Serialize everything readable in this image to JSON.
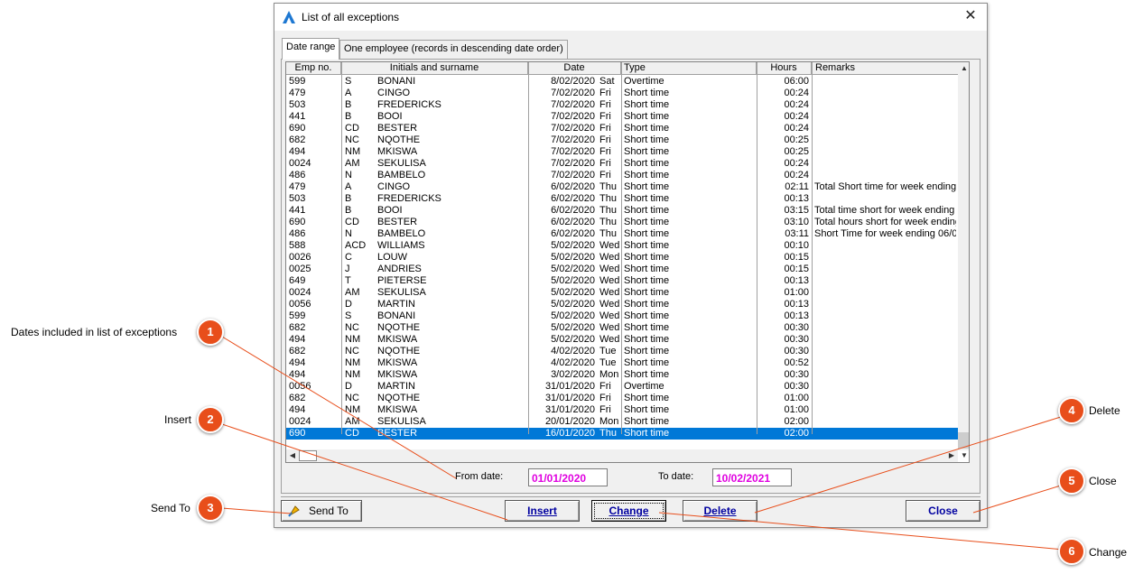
{
  "window": {
    "title": "List of all exceptions",
    "close_glyph": "✕"
  },
  "tabs": [
    {
      "label": "Date range"
    },
    {
      "label": "One employee (records in descending date order)"
    }
  ],
  "table": {
    "columns": [
      "Emp no.",
      "Initials and surname",
      "Date",
      "Type",
      "Hours",
      "Remarks"
    ],
    "rows": [
      [
        "599",
        "S",
        "BONANI",
        "8/02/2020",
        "Sat",
        "Overtime",
        "06:00",
        ""
      ],
      [
        "479",
        "A",
        "CINGO",
        "7/02/2020",
        "Fri",
        "Short time",
        "00:24",
        ""
      ],
      [
        "503",
        "B",
        "FREDERICKS",
        "7/02/2020",
        "Fri",
        "Short time",
        "00:24",
        ""
      ],
      [
        "441",
        "B",
        "BOOI",
        "7/02/2020",
        "Fri",
        "Short time",
        "00:24",
        ""
      ],
      [
        "690",
        "CD",
        "BESTER",
        "7/02/2020",
        "Fri",
        "Short time",
        "00:24",
        ""
      ],
      [
        "682",
        "NC",
        "NQOTHE",
        "7/02/2020",
        "Fri",
        "Short time",
        "00:25",
        ""
      ],
      [
        "494",
        "NM",
        "MKISWA",
        "7/02/2020",
        "Fri",
        "Short time",
        "00:25",
        ""
      ],
      [
        "0024",
        "AM",
        "SEKULISA",
        "7/02/2020",
        "Fri",
        "Short time",
        "00:24",
        ""
      ],
      [
        "486",
        "N",
        "BAMBELO",
        "7/02/2020",
        "Fri",
        "Short time",
        "00:24",
        ""
      ],
      [
        "479",
        "A",
        "CINGO",
        "6/02/2020",
        "Thu",
        "Short time",
        "02:11",
        "Total Short time for week ending"
      ],
      [
        "503",
        "B",
        "FREDERICKS",
        "6/02/2020",
        "Thu",
        "Short time",
        "00:13",
        ""
      ],
      [
        "441",
        "B",
        "BOOI",
        "6/02/2020",
        "Thu",
        "Short time",
        "03:15",
        "Total time short for week ending 0"
      ],
      [
        "690",
        "CD",
        "BESTER",
        "6/02/2020",
        "Thu",
        "Short time",
        "03:10",
        "Total hours short for week ending"
      ],
      [
        "486",
        "N",
        "BAMBELO",
        "6/02/2020",
        "Thu",
        "Short time",
        "03:11",
        "Short Time for week ending 06/0"
      ],
      [
        "588",
        "ACD",
        "WILLIAMS",
        "5/02/2020",
        "Wed",
        "Short time",
        "00:10",
        ""
      ],
      [
        "0026",
        "C",
        "LOUW",
        "5/02/2020",
        "Wed",
        "Short time",
        "00:15",
        ""
      ],
      [
        "0025",
        "J",
        "ANDRIES",
        "5/02/2020",
        "Wed",
        "Short time",
        "00:15",
        ""
      ],
      [
        "649",
        "T",
        "PIETERSE",
        "5/02/2020",
        "Wed",
        "Short time",
        "00:13",
        ""
      ],
      [
        "0024",
        "AM",
        "SEKULISA",
        "5/02/2020",
        "Wed",
        "Short time",
        "01:00",
        ""
      ],
      [
        "0056",
        "D",
        "MARTIN",
        "5/02/2020",
        "Wed",
        "Short time",
        "00:13",
        ""
      ],
      [
        "599",
        "S",
        "BONANI",
        "5/02/2020",
        "Wed",
        "Short time",
        "00:13",
        ""
      ],
      [
        "682",
        "NC",
        "NQOTHE",
        "5/02/2020",
        "Wed",
        "Short time",
        "00:30",
        ""
      ],
      [
        "494",
        "NM",
        "MKISWA",
        "5/02/2020",
        "Wed",
        "Short time",
        "00:30",
        ""
      ],
      [
        "682",
        "NC",
        "NQOTHE",
        "4/02/2020",
        "Tue",
        "Short time",
        "00:30",
        ""
      ],
      [
        "494",
        "NM",
        "MKISWA",
        "4/02/2020",
        "Tue",
        "Short time",
        "00:52",
        ""
      ],
      [
        "494",
        "NM",
        "MKISWA",
        "3/02/2020",
        "Mon",
        "Short time",
        "00:30",
        ""
      ],
      [
        "0056",
        "D",
        "MARTIN",
        "31/01/2020",
        "Fri",
        "Overtime",
        "00:30",
        ""
      ],
      [
        "682",
        "NC",
        "NQOTHE",
        "31/01/2020",
        "Fri",
        "Short time",
        "01:00",
        ""
      ],
      [
        "494",
        "NM",
        "MKISWA",
        "31/01/2020",
        "Fri",
        "Short time",
        "01:00",
        ""
      ],
      [
        "0024",
        "AM",
        "SEKULISA",
        "20/01/2020",
        "Mon",
        "Short time",
        "02:00",
        ""
      ],
      [
        "690",
        "CD",
        "BESTER",
        "16/01/2020",
        "Thu",
        "Short time",
        "02:00",
        ""
      ]
    ],
    "selected_row": 30
  },
  "filters": {
    "from_label": "From date:",
    "from_value": "01/01/2020",
    "to_label": "To date:",
    "to_value": "10/02/2021"
  },
  "buttons": {
    "send_to": "Send To",
    "insert": "Insert",
    "change": "Change",
    "delete": "Delete",
    "close": "Close"
  },
  "callouts": [
    {
      "num": "1",
      "label": "Dates included in list of exceptions"
    },
    {
      "num": "2",
      "label": "Insert"
    },
    {
      "num": "3",
      "label": "Send To"
    },
    {
      "num": "4",
      "label": "Delete"
    },
    {
      "num": "5",
      "label": "Close"
    },
    {
      "num": "6",
      "label": "Change"
    }
  ],
  "colors": {
    "callout": "#e84e1b",
    "selection": "#0078d7",
    "date_text": "#e000e0",
    "button_text": "#0000a0"
  }
}
